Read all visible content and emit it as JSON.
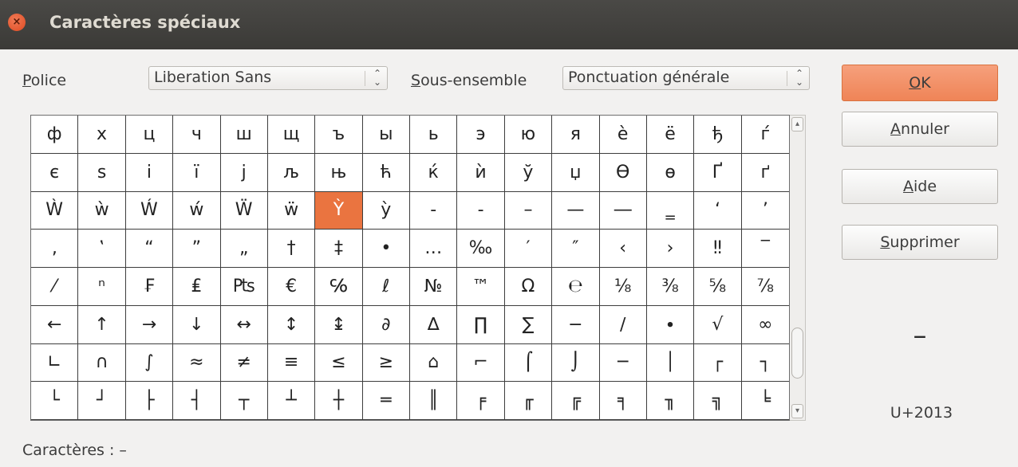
{
  "window": {
    "title": "Caractères spéciaux",
    "close_glyph": "×"
  },
  "font": {
    "label_u": "P",
    "label_rest": "olice",
    "value": "Liberation Sans",
    "arrows": "⌃⌄"
  },
  "subset": {
    "label_u": "S",
    "label_rest": "ous-ensemble",
    "value": "Ponctuation générale",
    "arrows": "⌃⌄"
  },
  "grid": {
    "selected_index": 38,
    "cells": [
      "ф",
      "х",
      "ц",
      "ч",
      "ш",
      "щ",
      "ъ",
      "ы",
      "ь",
      "э",
      "ю",
      "я",
      "è",
      "ë",
      "ђ",
      "ѓ",
      "є",
      "ѕ",
      "і",
      "ї",
      "ј",
      "љ",
      "њ",
      "ћ",
      "ќ",
      "ѝ",
      "ў",
      "џ",
      "Ѳ",
      "ѳ",
      "Ґ",
      "ґ",
      "Ẁ",
      "ẁ",
      "Ẃ",
      "ẃ",
      "Ẅ",
      "ẅ",
      "Ỳ",
      "ỳ",
      "‐",
      "‑",
      "–",
      "—",
      "―",
      "‗",
      "‘",
      "’",
      "‚",
      "‛",
      "“",
      "”",
      "„",
      "†",
      "‡",
      "•",
      "…",
      "‰",
      "′",
      "″",
      "‹",
      "›",
      "‼",
      "‾",
      "⁄",
      "ⁿ",
      "₣",
      "₤",
      "₧",
      "€",
      "℅",
      "ℓ",
      "№",
      "™",
      "Ω",
      "℮",
      "⅛",
      "⅜",
      "⅝",
      "⅞",
      "←",
      "↑",
      "→",
      "↓",
      "↔",
      "↕",
      "↨",
      "∂",
      "∆",
      "∏",
      "∑",
      "−",
      "∕",
      "∙",
      "√",
      "∞",
      "∟",
      "∩",
      "∫",
      "≈",
      "≠",
      "≡",
      "≤",
      "≥",
      "⌂",
      "⌐",
      "⌠",
      "⌡",
      "─",
      "│",
      "┌",
      "┐",
      "└",
      "┘",
      "├",
      "┤",
      "┬",
      "┴",
      "┼",
      "═",
      "║",
      "╒",
      "╓",
      "╔",
      "╕",
      "╖",
      "╗",
      "╘"
    ]
  },
  "buttons": {
    "ok_u": "O",
    "ok_rest": "K",
    "cancel_u": "A",
    "cancel_rest": "nnuler",
    "help_u": "A",
    "help_rest": "ide",
    "delete_u": "S",
    "delete_rest": "upprimer"
  },
  "preview": {
    "glyph": "–",
    "codepoint": "U+2013"
  },
  "characters": {
    "label": "Caractères :",
    "value": "–"
  },
  "scrollbar": {
    "up": "▴",
    "down": "▾"
  },
  "colors": {
    "selection": "#ea7440",
    "ok_button": "#ef8457",
    "titlebar": "#3b3a37"
  }
}
